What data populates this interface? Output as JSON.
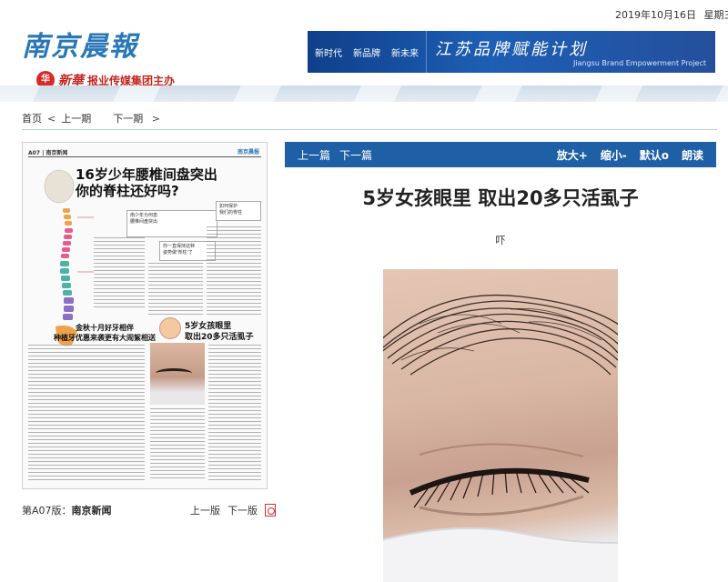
{
  "header": {
    "date": "2019年10月16日",
    "weekday": "星期三",
    "logo_text": "南京晨報",
    "org_script": "新華",
    "org_text": "报业传媒集团主办",
    "banner": {
      "slogans": [
        "新时代",
        "新品牌",
        "新未来"
      ],
      "title": "江苏品牌赋能计划",
      "subtitle": "Jiangsu Brand Empowerment Project"
    }
  },
  "breadcrumb": {
    "home": "首页",
    "prev": "上一期",
    "next": "下一期"
  },
  "newspaper_page": {
    "header_left": "A07 | 南京新闻",
    "header_logo": "南京晨报",
    "headline_main": "16岁少年腰椎间盘突出\n你的脊柱还好吗?",
    "headline_secondary": "金秋十月好牙相伴\n种植牙优惠来袭更有大闹絮相送",
    "headline_eye": "5岁女孩眼里\n取出20多只活虱子",
    "box1": "南少年为何患\n腰椎间盘突出",
    "box2": "你一直保持这种\n姿势做'脊柱'了",
    "box3": "如何保护\n我们的脊柱"
  },
  "edition": {
    "label": "第A07版：",
    "name": "南京新闻",
    "prev": "上一版",
    "next": "下一版"
  },
  "article": {
    "nav_prev": "上一篇",
    "nav_next": "下一篇",
    "tools": {
      "zoom_in": "放大+",
      "zoom_out": "缩小-",
      "read_aloud": "默认o",
      "speak": "朗读"
    },
    "title": "5岁女孩眼里 取出20多只活虱子",
    "author": "吓"
  },
  "colors": {
    "accent_blue": "#1f5fa5",
    "logo_blue": "#2a77b8",
    "org_red": "#c2271f"
  }
}
